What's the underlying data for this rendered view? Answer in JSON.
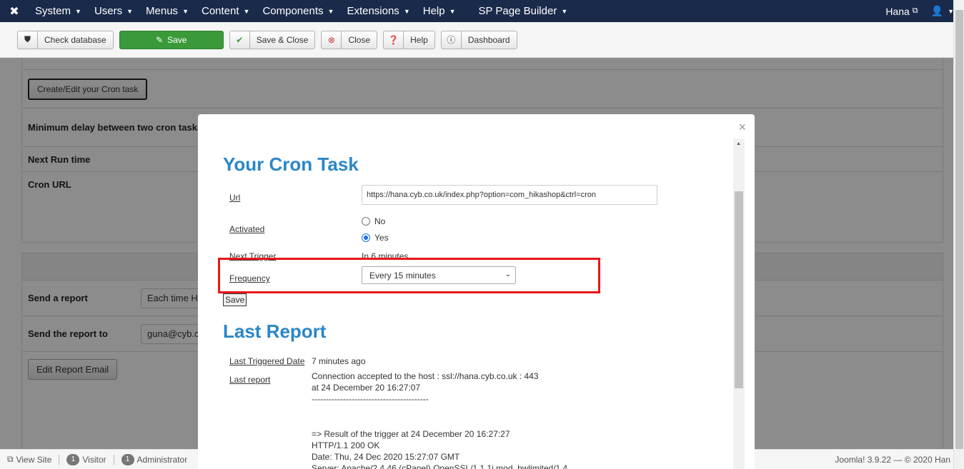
{
  "navbar": {
    "logo": "✖",
    "items": [
      "System",
      "Users",
      "Menus",
      "Content",
      "Components",
      "Extensions",
      "Help",
      "SP Page Builder"
    ],
    "user": "Hana",
    "user_icon": "person-icon"
  },
  "toolbar": {
    "check_database": "Check database",
    "save": "Save",
    "save_close": "Save & Close",
    "close": "Close",
    "help": "Help",
    "dashboard": "Dashboard"
  },
  "background": {
    "create_edit_cron": "Create/Edit your Cron task",
    "min_delay_label": "Minimum delay between two cron tasks",
    "next_run_label": "Next Run time",
    "cron_url_label": "Cron URL",
    "send_report_label": "Send a report",
    "send_report_value": "Each time H",
    "send_to_label": "Send the report to",
    "send_to_value": "guna@cyb.c",
    "edit_report_email": "Edit Report Email"
  },
  "statusbar": {
    "view_site": "View Site",
    "visitor_count": "1",
    "visitor_label": "Visitor",
    "admin_count": "1",
    "admin_label": "Administrator",
    "right_text": "Joomla! 3.9.22 — © 2020 Han"
  },
  "modal": {
    "close": "×",
    "title_cron": "Your Cron Task",
    "url_label": "Url",
    "url_value": "https://hana.cyb.co.uk/index.php?option=com_hikashop&ctrl=cron",
    "activated_label": "Activated",
    "opt_no": "No",
    "opt_yes": "Yes",
    "next_trigger_label": "Next Trigger",
    "next_trigger_value": "In 6 minutes",
    "frequency_label": "Frequency",
    "frequency_value": "Every 15 minutes",
    "save": "Save",
    "title_report": "Last Report",
    "last_triggered_label": "Last Triggered Date",
    "last_triggered_value": "7 minutes ago",
    "last_report_label": "Last report",
    "report_line1": "Connection accepted to the host : ssl://hana.cyb.co.uk : 443",
    "report_line2": "at 24 December 20 16:27:07",
    "report_line3": "-----------------------------------------",
    "report_line4": "=> Result of the trigger at 24 December 20 16:27:27",
    "report_line5": "HTTP/1.1 200 OK",
    "report_line6": "Date: Thu, 24 Dec 2020 15:27:07 GMT",
    "report_line7": "Server: Apache/2.4.46 (cPanel) OpenSSL/1.1.1i mod_bwlimited/1.4"
  }
}
